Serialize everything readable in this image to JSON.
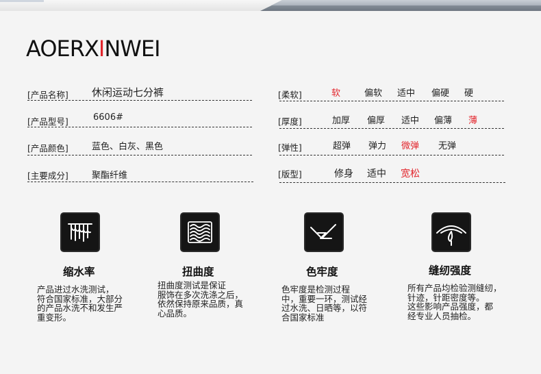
{
  "brand": {
    "prefix": "AOERX",
    "accent": "I",
    "suffix": "NWEI"
  },
  "specs": [
    {
      "label": "[产品名称]",
      "value": "休闲运动七分裤"
    },
    {
      "label": "[产品型号]",
      "value": "6606#"
    },
    {
      "label": "[产品颜色]",
      "value": "蓝色、白灰、黑色"
    },
    {
      "label": "[主要成分]",
      "value": "聚酯纤维"
    }
  ],
  "attributes": [
    {
      "label": "[柔软]",
      "options": [
        "软",
        "偏软",
        "适中",
        "偏硬",
        "硬"
      ],
      "selected": "软"
    },
    {
      "label": "[厚度]",
      "options": [
        "加厚",
        "偏厚",
        "适中",
        "偏薄",
        "薄"
      ],
      "selected": "薄"
    },
    {
      "label": "[弹性]",
      "options": [
        "超弹",
        "弹力",
        "微弹",
        "无弹"
      ],
      "selected": "微弹"
    },
    {
      "label": "[版型]",
      "options": [
        "修身",
        "适中",
        "宽松"
      ],
      "selected": "宽松"
    }
  ],
  "features": [
    {
      "icon": "shrinkage-icon",
      "title": "缩水率",
      "desc": [
        "产品进过水洗测试，",
        "符合国家标准，大部分",
        "的产品水洗不和发生严",
        "重变形。"
      ]
    },
    {
      "icon": "twist-icon",
      "title": "扭曲度",
      "desc": [
        "扭曲度测试是保证",
        "服饰在多次洗涤之后，",
        "依然保持原来品质，真",
        "心品质。"
      ]
    },
    {
      "icon": "colorfastness-icon",
      "title": "色牢度",
      "desc": [
        "色牢度是检测过程",
        "中，重要一环，测试经",
        "过水洗、日晒等，以符",
        "合国家标准"
      ]
    },
    {
      "icon": "seam-strength-icon",
      "title": "缝纫强度",
      "desc": [
        "所有产品均检验测缝纫，",
        "针迹，针距密度等。",
        "这些影响产品强度，都",
        "经专业人员抽检。"
      ]
    }
  ],
  "colors": {
    "accent": "#e2242b",
    "icon_bg": "#151515"
  }
}
